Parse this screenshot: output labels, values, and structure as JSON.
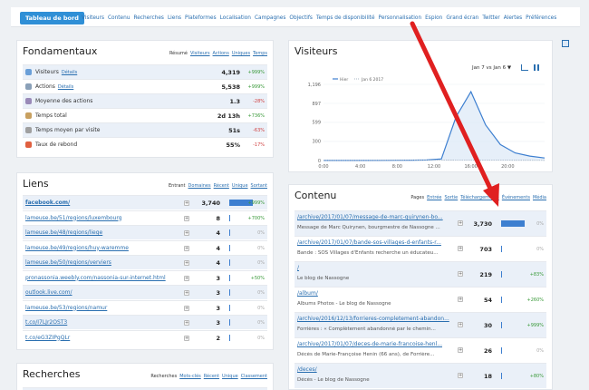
{
  "nav": {
    "dashboard": "Tableau de bord",
    "items": [
      "Visiteurs",
      "Contenu",
      "Recherches",
      "Liens",
      "Plateformes",
      "Localisation",
      "Campagnes",
      "Objectifs",
      "Temps de disponibilité",
      "Personnalisation",
      "Espion",
      "Grand écran",
      "Twitter",
      "Alertes",
      "Préférences"
    ]
  },
  "fond": {
    "title": "Fondamentaux",
    "links": [
      "Résumé",
      "Visiteurs",
      "Actions",
      "Uniques",
      "Temps"
    ],
    "rows": [
      {
        "label": "Visiteurs",
        "detail": "Détails",
        "value": "4,319",
        "pct": "+999%",
        "tone": "pos",
        "icon": "#6a9fd8"
      },
      {
        "label": "Actions",
        "detail": "Détails",
        "value": "5,538",
        "pct": "+999%",
        "tone": "pos",
        "icon": "#8aa0b8"
      },
      {
        "label": "Moyenne des actions",
        "detail": "",
        "value": "1.3",
        "pct": "-28%",
        "tone": "neg",
        "icon": "#9a8ab8"
      },
      {
        "label": "Temps total",
        "detail": "",
        "value": "2d 13h",
        "pct": "+736%",
        "tone": "pos",
        "icon": "#c8a060"
      },
      {
        "label": "Temps moyen par visite",
        "detail": "",
        "value": "51s",
        "pct": "-63%",
        "tone": "neg",
        "icon": "#a0a0a0"
      },
      {
        "label": "Taux de rebond",
        "detail": "",
        "value": "55%",
        "pct": "-17%",
        "tone": "neg",
        "icon": "#e06040"
      }
    ]
  },
  "visiteurs": {
    "title": "Visiteurs",
    "range": "Jan 7 vs Jan 6 ▼",
    "legend": [
      "Hier",
      "Jan 6 2017"
    ]
  },
  "chart_data": {
    "type": "line",
    "x": [
      "0:00",
      "2:00",
      "4:00",
      "6:00",
      "8:00",
      "10:00",
      "12:00",
      "14:00",
      "16:00",
      "18:00",
      "20:00",
      "22:00"
    ],
    "series": [
      {
        "name": "Hier",
        "values": [
          2,
          2,
          1,
          1,
          3,
          4,
          6,
          8,
          25,
          690,
          1080,
          560,
          250,
          120,
          70,
          40
        ]
      },
      {
        "name": "Jan 6 2017",
        "values": [
          3,
          2,
          2,
          2,
          4,
          5,
          6,
          7,
          7,
          6,
          6,
          5,
          5,
          4,
          4,
          3
        ]
      }
    ],
    "xticks": [
      "0:00",
      "4:00",
      "8:00",
      "12:00",
      "16:00",
      "20:00"
    ],
    "yticks": [
      "0",
      "300",
      "599",
      "897",
      "1,196"
    ],
    "ylim": [
      0,
      1196
    ]
  },
  "liens": {
    "title": "Liens",
    "links": [
      "Entrant",
      "Domaines",
      "Récent",
      "Unique",
      "Sortant"
    ],
    "rows": [
      {
        "label": "facebook.com/",
        "value": "3,740",
        "pct": "+999%",
        "tone": "pos",
        "bar": true
      },
      {
        "label": "lameuse.be/51/regions/luxembourg",
        "value": "8",
        "pct": "+700%",
        "tone": "pos",
        "bar": false
      },
      {
        "label": "lameuse.be/48/regions/liege",
        "value": "4",
        "pct": "0%",
        "tone": "zero",
        "bar": false
      },
      {
        "label": "lameuse.be/49/regions/huy-waremme",
        "value": "4",
        "pct": "0%",
        "tone": "zero",
        "bar": false
      },
      {
        "label": "lameuse.be/50/regions/verviers",
        "value": "4",
        "pct": "0%",
        "tone": "zero",
        "bar": false
      },
      {
        "label": "pronassonia.weebly.com/nassonia-sur-internet.html",
        "value": "3",
        "pct": "+50%",
        "tone": "pos",
        "bar": false
      },
      {
        "label": "outlook.live.com/",
        "value": "3",
        "pct": "0%",
        "tone": "zero",
        "bar": false
      },
      {
        "label": "lameuse.be/53/regions/namur",
        "value": "3",
        "pct": "0%",
        "tone": "zero",
        "bar": false
      },
      {
        "label": "t.co/I7LJr2OST3",
        "value": "3",
        "pct": "0%",
        "tone": "zero",
        "bar": false
      },
      {
        "label": "t.co/eG3ZIPgQLr",
        "value": "2",
        "pct": "0%",
        "tone": "zero",
        "bar": false
      }
    ]
  },
  "contenu": {
    "title": "Contenu",
    "links": [
      "Pages",
      "Entrée",
      "Sortie",
      "Téléchargements",
      "Événements",
      "Média"
    ],
    "rows": [
      {
        "url": "/archive/2017/01/07/message-de-marc-quirynen-bo...",
        "desc": "Message de Marc Quirynen, bourgmestre de Nassogne ...",
        "value": "3,730",
        "pct": "0%",
        "tone": "zero",
        "bar": true
      },
      {
        "url": "/archive/2017/01/07/bande-sos-villages-d-enfants-r...",
        "desc": "Bande : SOS Villages d'Enfants recherche un éducateu...",
        "value": "703",
        "pct": "0%",
        "tone": "zero",
        "bar": false
      },
      {
        "url": "/",
        "desc": "Le blog de Nassogne",
        "value": "219",
        "pct": "+83%",
        "tone": "pos",
        "bar": false
      },
      {
        "url": "/album/",
        "desc": "Albums Photos - Le blog de Nassogne",
        "value": "54",
        "pct": "+260%",
        "tone": "pos",
        "bar": false
      },
      {
        "url": "/archive/2016/12/13/forrieres-completement-abandon...",
        "desc": "Forrières : « Complètement abandonné par le chemin...",
        "value": "30",
        "pct": "+999%",
        "tone": "pos",
        "bar": false
      },
      {
        "url": "/archive/2017/01/07/deces-de-marie-francoise-henl...",
        "desc": "Décès de Marie-Françoise Henin (66 ans), de Forrière...",
        "value": "26",
        "pct": "0%",
        "tone": "zero",
        "bar": false
      },
      {
        "url": "/deces/",
        "desc": "Décès - Le blog de Nassogne",
        "value": "18",
        "pct": "+80%",
        "tone": "pos",
        "bar": false
      }
    ]
  },
  "recherches": {
    "title": "Recherches",
    "links": [
      "Recherches",
      "Mots-clés",
      "Récent",
      "Unique",
      "Classement"
    ]
  },
  "colors": {
    "accent": "#2f8fd6",
    "bar": "#3d7fd0",
    "arrow": "#e02020"
  }
}
